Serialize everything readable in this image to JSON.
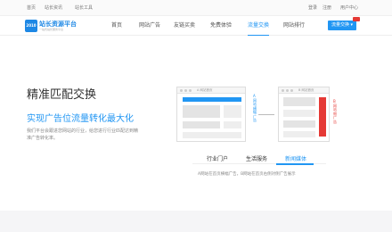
{
  "topbar": {
    "links": [
      "首页",
      "站长资讯",
      "站长工具"
    ],
    "right": [
      "登录",
      "注册",
      "用户中心"
    ]
  },
  "logo": {
    "badge": "2010",
    "name": "站长资源平台",
    "tagline": "一站式站长服务平台"
  },
  "nav": {
    "items": [
      {
        "label": "首页",
        "active": false
      },
      {
        "label": "网站广告",
        "active": false
      },
      {
        "label": "友链买卖",
        "active": false
      },
      {
        "label": "免费体验",
        "active": false
      },
      {
        "label": "流量交换",
        "active": true
      },
      {
        "label": "网站排行",
        "active": false
      }
    ],
    "cta_label": "流量交换 ▾"
  },
  "hero": {
    "title": "精准匹配交换",
    "subtitle": "实现广告位流量转化最大化",
    "description": "我们平台会跟进您网站的行业，给您进行行业匹配达到精准广告转化率。"
  },
  "illustration": {
    "left_window_title": "A 网站首页",
    "right_window_title": "B 网站首页",
    "left_label": "A网站横幅广告",
    "right_label": "B网站侧广告"
  },
  "tabs": {
    "items": [
      {
        "label": "行业门户",
        "active": false
      },
      {
        "label": "生活服务",
        "active": false
      },
      {
        "label": "新闻媒体",
        "active": true
      }
    ],
    "description": "A网站在首页横幅广告，B网站在首页右侧对侧广告展示"
  },
  "colors": {
    "accent": "#2196f3",
    "highlight": "#e53935"
  }
}
